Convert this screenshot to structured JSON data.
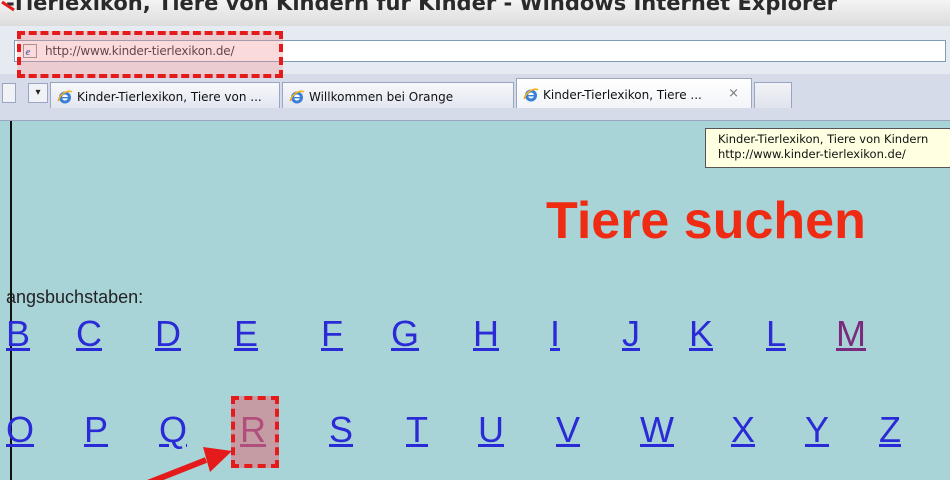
{
  "window": {
    "title": "-Tierlexikon, Tiere von Kindern für Kinder - Windows Internet Explorer"
  },
  "address_bar": {
    "url": "http://www.kinder-tierlexikon.de/",
    "icon": "ie-page-icon"
  },
  "tabs": [
    {
      "label": "Kinder-Tierlexikon, Tiere von ...",
      "icon": "ie-icon",
      "active": false
    },
    {
      "label": "Willkommen bei Orange",
      "icon": "ie-icon",
      "active": false
    },
    {
      "label": "Kinder-Tierlexikon, Tiere ...",
      "icon": "ie-icon",
      "active": true,
      "close": "×"
    }
  ],
  "tab_controls": {
    "dropdown": "▾"
  },
  "tooltip": {
    "line1": "Kinder-Tierlexikon, Tiere von Kindern",
    "line2": "http://www.kinder-tierlexikon.de/"
  },
  "page": {
    "heading": "Tiere suchen",
    "label": "angsbuchstaben:",
    "row1": [
      "B",
      "C",
      "D",
      "E",
      "F",
      "G",
      "H",
      "I",
      "J",
      "K",
      "L",
      "M"
    ],
    "row2": [
      "O",
      "P",
      "Q",
      "R",
      "S",
      "T",
      "U",
      "V",
      "W",
      "X",
      "Y",
      "Z"
    ]
  },
  "colors": {
    "page_background": "#a8d4d8",
    "heading": "#ef2b13",
    "link": "#2a2ad6",
    "visited_link": "#7b2b7e",
    "annotation": "#e51a1a"
  }
}
